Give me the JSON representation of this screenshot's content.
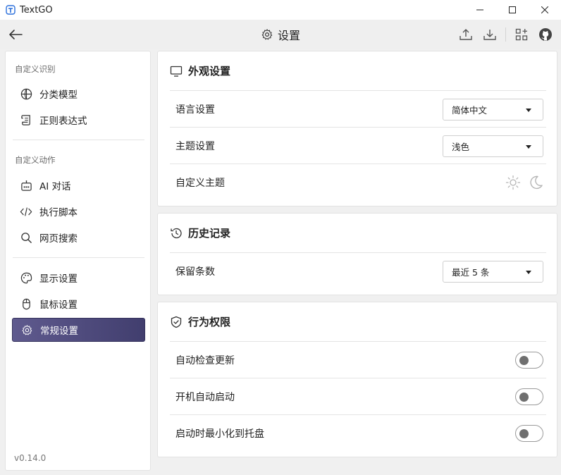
{
  "window": {
    "title": "TextGO"
  },
  "header": {
    "title": "设置"
  },
  "sidebar": {
    "sections": [
      {
        "label": "自定义识别"
      },
      {
        "label": "自定义动作"
      }
    ],
    "items": [
      {
        "label": "分类模型",
        "icon": "globe-icon"
      },
      {
        "label": "正则表达式",
        "icon": "scroll-icon"
      },
      {
        "label": "AI 对话",
        "icon": "robot-icon"
      },
      {
        "label": "执行脚本",
        "icon": "code-icon"
      },
      {
        "label": "网页搜索",
        "icon": "search-icon"
      },
      {
        "label": "显示设置",
        "icon": "palette-icon"
      },
      {
        "label": "鼠标设置",
        "icon": "mouse-icon"
      },
      {
        "label": "常规设置",
        "icon": "gear-icon",
        "active": true
      }
    ],
    "version": "v0.14.0"
  },
  "appearance": {
    "title": "外观设置",
    "language": {
      "label": "语言设置",
      "value": "简体中文"
    },
    "theme": {
      "label": "主题设置",
      "value": "浅色"
    },
    "custom_theme": {
      "label": "自定义主题"
    }
  },
  "history": {
    "title": "历史记录",
    "retain": {
      "label": "保留条数",
      "value": "最近 5 条"
    }
  },
  "behavior": {
    "title": "行为权限",
    "auto_update": {
      "label": "自动检查更新",
      "enabled": false
    },
    "autostart": {
      "label": "开机自动启动",
      "enabled": false
    },
    "minimize_tray": {
      "label": "启动时最小化到托盘",
      "enabled": false
    }
  },
  "colors": {
    "active_item_start": "#5f5a8e",
    "active_item_end": "#413e6e",
    "accent_icon": "#2a6fdb"
  }
}
